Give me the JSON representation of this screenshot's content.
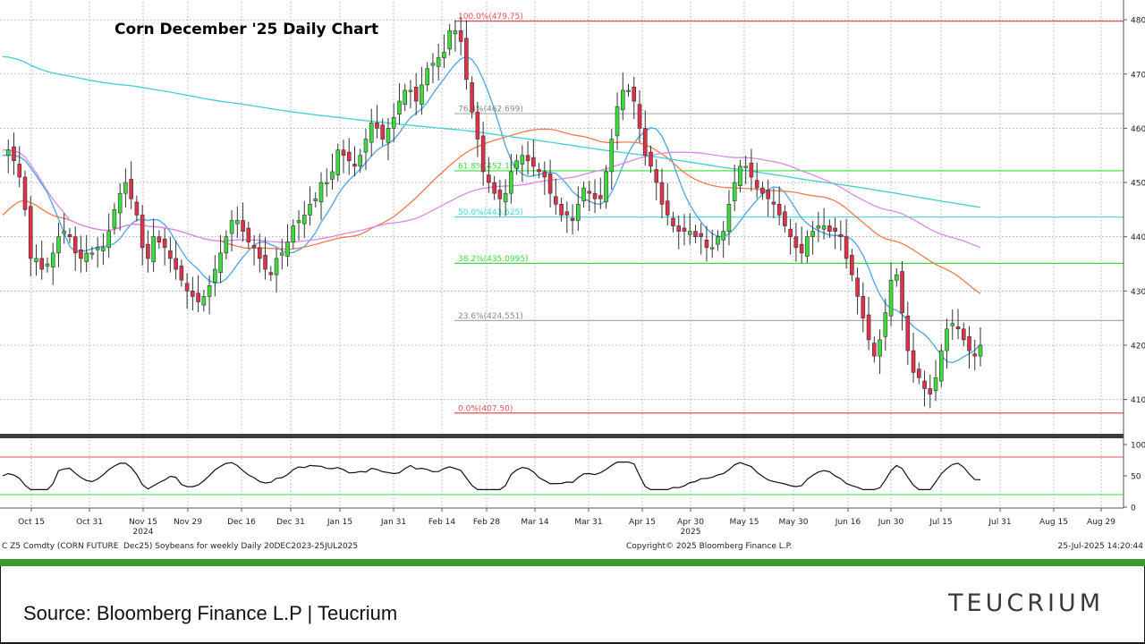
{
  "chart_data": [
    {
      "type": "candlestick",
      "title": "Corn December '25 Daily Chart",
      "y_ticks": [
        "480",
        "470",
        "460",
        "450",
        "440",
        "430",
        "420",
        "410"
      ],
      "ylim": [
        404,
        482
      ],
      "x_ticks": [
        "Oct 15",
        "Oct 31",
        "Nov 15",
        "Nov 29",
        "Dec 16",
        "Dec 31",
        "Jan 15",
        "Jan 31",
        "Feb 14",
        "Feb 28",
        "Mar 14",
        "Mar 31",
        "Apr 15",
        "Apr 30",
        "May 15",
        "May 30",
        "Jun 16",
        "Jun 30",
        "Jul 15",
        "Jul 31",
        "Aug 15",
        "Aug 29"
      ],
      "year_labels": [
        {
          "label": "2024",
          "at_tick": "Nov 15"
        },
        {
          "label": "2025",
          "at_tick": "Apr 30"
        }
      ],
      "grid": true,
      "legend": "none",
      "fibonacci": [
        {
          "label": "100.0%(479.75)",
          "value": 479.75,
          "color": "#e05050"
        },
        {
          "label": "76.4%(462.699)",
          "value": 462.699,
          "color": "#aaaaaa"
        },
        {
          "label": "61.8%(452.164)",
          "value": 452.164,
          "color": "#3ddc3d"
        },
        {
          "label": "50.0%(443.625)",
          "value": 443.625,
          "color": "#40d8d8"
        },
        {
          "label": "38.2%(435.0995)",
          "value": 435.0995,
          "color": "#3ddc3d"
        },
        {
          "label": "23.6%(424.551)",
          "value": 424.551,
          "color": "#aaaaaa"
        },
        {
          "label": "0.0%(407.50)",
          "value": 407.5,
          "color": "#e05050"
        }
      ],
      "closes": [
        455,
        456,
        454,
        451,
        445,
        436,
        436,
        434,
        435,
        437,
        440,
        441,
        440,
        437,
        436,
        437,
        437,
        438,
        438,
        441,
        445,
        448,
        450,
        447,
        444,
        438,
        436,
        440,
        439,
        438,
        436,
        434,
        432,
        430,
        429,
        428,
        429,
        431,
        434,
        437,
        440,
        443,
        443,
        441,
        439,
        438,
        436,
        434,
        433,
        436,
        437,
        439,
        442,
        443,
        444,
        446,
        447,
        450,
        450,
        452,
        456,
        455,
        454,
        453,
        455,
        458,
        461,
        460,
        458,
        460,
        462,
        465,
        467,
        467,
        465,
        468,
        471,
        472,
        473,
        474,
        478,
        478,
        476,
        469,
        463,
        458,
        452,
        450,
        448,
        447,
        448,
        452,
        454,
        455,
        454,
        453,
        452,
        451,
        448,
        446,
        444,
        444,
        443,
        446,
        449,
        448,
        447,
        447,
        452,
        458,
        464,
        467,
        467,
        465,
        460,
        455,
        453,
        450,
        446,
        444,
        442,
        441,
        441,
        441,
        440,
        440,
        438,
        438,
        440,
        441,
        446,
        450,
        453,
        453,
        451,
        449,
        448,
        447,
        446,
        444,
        442,
        440,
        438,
        437,
        440,
        441,
        442,
        442,
        441,
        441,
        440,
        436,
        433,
        429,
        425,
        421,
        418,
        421,
        426,
        432,
        433,
        426,
        419,
        415,
        414,
        412,
        411,
        414,
        419,
        423,
        424,
        423,
        421,
        419,
        418,
        420
      ]
    },
    {
      "type": "line",
      "y_ticks": [
        "100",
        "50",
        "0"
      ],
      "ylim": [
        0,
        100
      ],
      "reference_lines": [
        80,
        20
      ]
    }
  ],
  "info": {
    "ticker": "C Z5 Comdty (CORN FUTURE",
    "desc": "Dec25) Soybeans for weekly  Daily 20DEC2023-25JUL2025",
    "copyright": "Copyright© 2025 Bloomberg Finance L.P.",
    "timestamp": "25-Jul-2025 14:20:44"
  },
  "footer": {
    "source": "Source: Bloomberg Finance L.P | Teucrium",
    "brand": "TEUCRIUM"
  },
  "colors": {
    "up": "#3ddc3d",
    "down": "#e0304a",
    "ma_fast": "#4aa3e8",
    "ma_mid": "#f07a50",
    "ma_slow": "#d88ae6",
    "ma_long": "#40d0d0",
    "footer_band": "#3a9a2a"
  }
}
